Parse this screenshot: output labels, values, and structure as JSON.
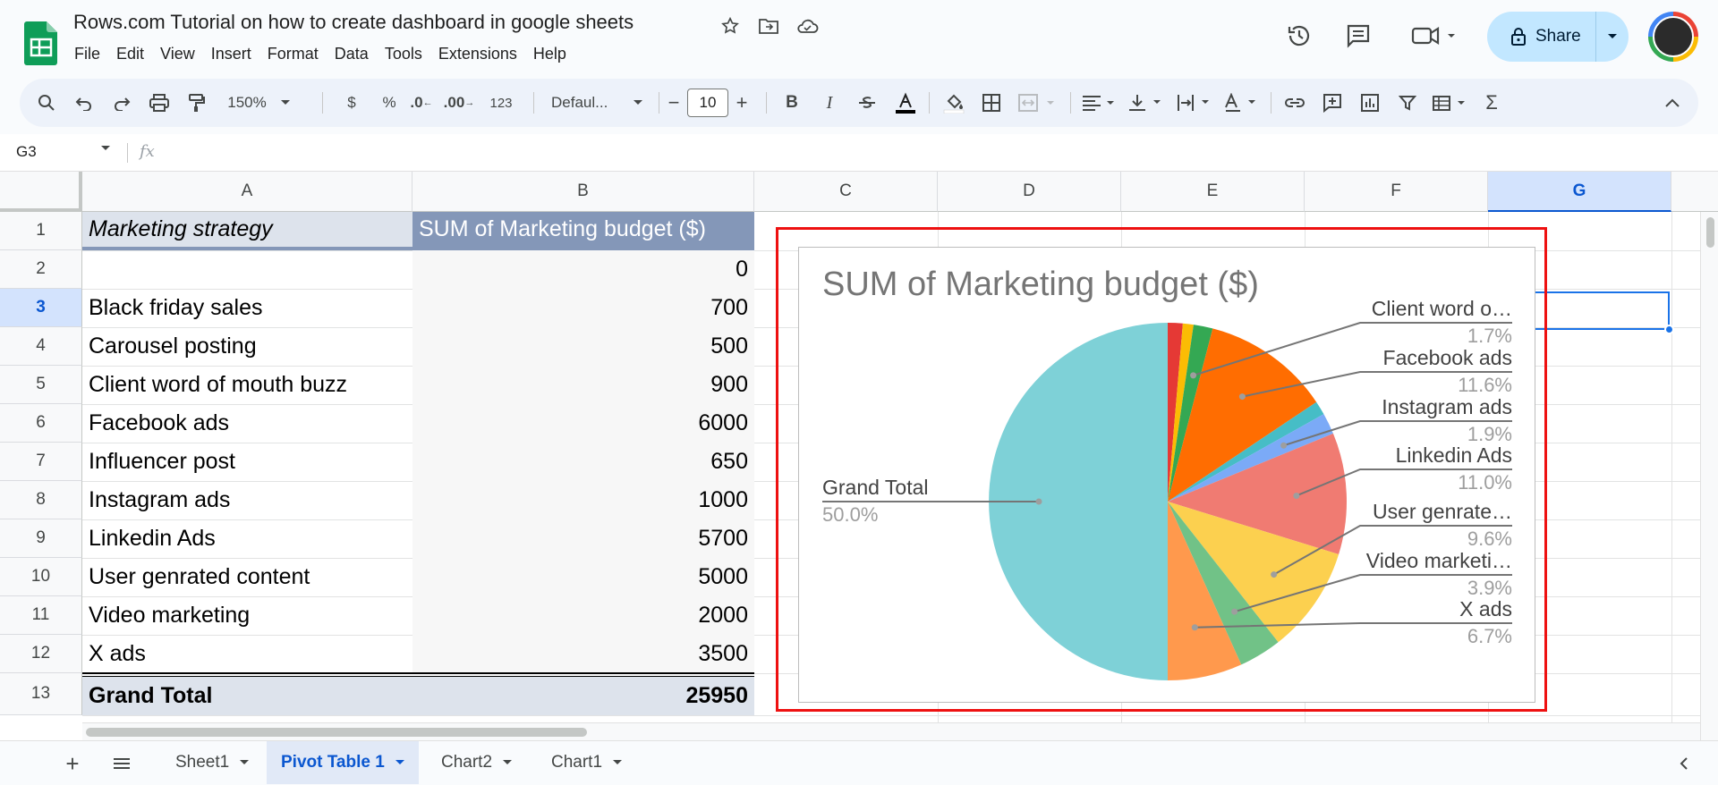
{
  "document": {
    "title": "Rows.com Tutorial on how to create dashboard in google sheets"
  },
  "menu": [
    "File",
    "Edit",
    "View",
    "Insert",
    "Format",
    "Data",
    "Tools",
    "Extensions",
    "Help"
  ],
  "header": {
    "share_label": "Share"
  },
  "toolbar": {
    "zoom": "150%",
    "currency": "$",
    "percent": "%",
    "decrease_decimal": ".0",
    "increase_decimal": ".00",
    "number_format": "123",
    "font": "Defaul...",
    "font_size": "10",
    "bold": "B",
    "italic": "I",
    "sum_symbol": "Σ"
  },
  "formula_bar": {
    "cell_ref": "G3",
    "fx": "fx",
    "value": ""
  },
  "columns": [
    "A",
    "B",
    "C",
    "D",
    "E",
    "F",
    "G"
  ],
  "selected_column": "G",
  "rows": [
    "1",
    "2",
    "3",
    "4",
    "5",
    "6",
    "7",
    "8",
    "9",
    "10",
    "11",
    "12",
    "13"
  ],
  "selected_row": "3",
  "pivot": {
    "header_a": "Marketing strategy",
    "header_b": "SUM of Marketing budget ($)",
    "data": [
      {
        "label": "",
        "value": "0"
      },
      {
        "label": "Black friday sales",
        "value": "700"
      },
      {
        "label": "Carousel posting",
        "value": "500"
      },
      {
        "label": "Client word of mouth buzz",
        "value": "900"
      },
      {
        "label": "Facebook ads",
        "value": "6000"
      },
      {
        "label": "Influencer post",
        "value": "650"
      },
      {
        "label": "Instagram ads",
        "value": "1000"
      },
      {
        "label": "Linkedin Ads",
        "value": "5700"
      },
      {
        "label": "User genrated content",
        "value": "5000"
      },
      {
        "label": "Video marketing",
        "value": "2000"
      },
      {
        "label": "X ads",
        "value": "3500"
      }
    ],
    "total_label": "Grand Total",
    "total_value": "25950"
  },
  "chart_data": {
    "type": "pie",
    "title": "SUM of Marketing budget ($)",
    "categories": [
      "Black friday sales",
      "Carousel posting",
      "Client word of mouth buzz",
      "Facebook ads",
      "Influencer post",
      "Instagram ads",
      "Linkedin Ads",
      "User genrated content",
      "Video marketing",
      "X ads",
      "Grand Total"
    ],
    "values": [
      700,
      500,
      900,
      6000,
      650,
      1000,
      5700,
      5000,
      2000,
      3500,
      25950
    ],
    "colors": [
      "#e53935",
      "#fbbc04",
      "#34a853",
      "#ff6d01",
      "#46bdc6",
      "#7baaf7",
      "#f07b72",
      "#fcd04f",
      "#71c287",
      "#ff994d",
      "#7ed1d7"
    ],
    "labels": [
      {
        "name": "Client word o…",
        "pct": "1.7%"
      },
      {
        "name": "Facebook ads",
        "pct": "11.6%"
      },
      {
        "name": "Instagram ads",
        "pct": "1.9%"
      },
      {
        "name": "Linkedin Ads",
        "pct": "11.0%"
      },
      {
        "name": "User genrate…",
        "pct": "9.6%"
      },
      {
        "name": "Video marketi…",
        "pct": "3.9%"
      },
      {
        "name": "X ads",
        "pct": "6.7%"
      },
      {
        "name": "Grand Total",
        "pct": "50.0%"
      }
    ]
  },
  "sheets": [
    {
      "name": "Sheet1",
      "active": false
    },
    {
      "name": "Pivot Table 1",
      "active": true
    },
    {
      "name": "Chart2",
      "active": false
    },
    {
      "name": "Chart1",
      "active": false
    }
  ]
}
